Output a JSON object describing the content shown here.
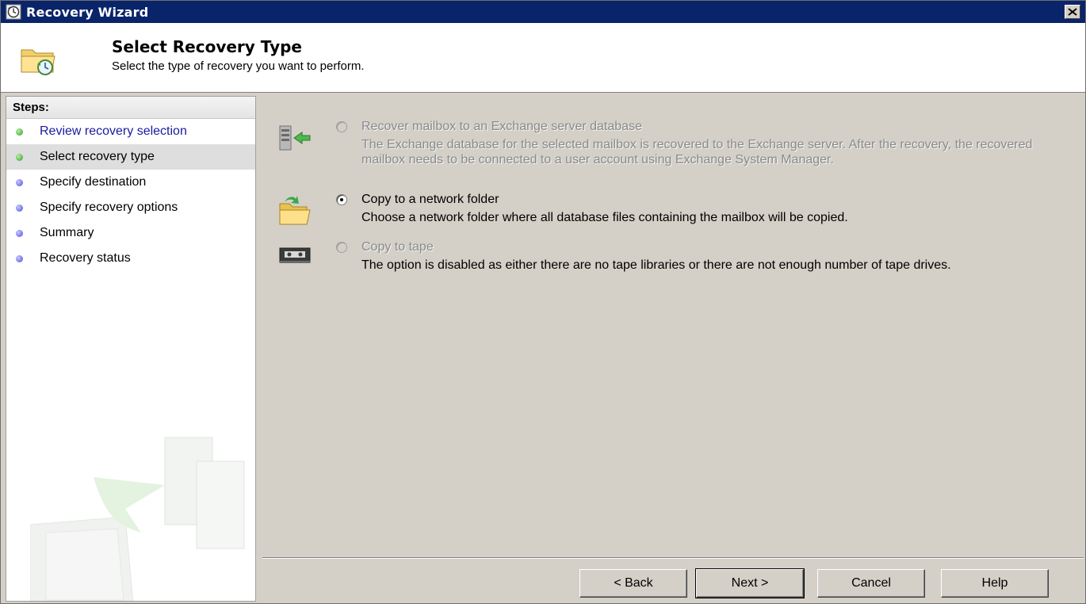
{
  "window": {
    "title": "Recovery Wizard",
    "close_icon": "close-icon"
  },
  "header": {
    "title": "Select Recovery Type",
    "subtitle": "Select the type of recovery you want to perform."
  },
  "steps": {
    "header": "Steps:",
    "items": [
      {
        "label": "Review recovery selection",
        "status": "done"
      },
      {
        "label": "Select recovery type",
        "status": "current"
      },
      {
        "label": "Specify destination",
        "status": "todo"
      },
      {
        "label": "Specify recovery options",
        "status": "todo"
      },
      {
        "label": "Summary",
        "status": "todo"
      },
      {
        "label": "Recovery status",
        "status": "todo"
      }
    ]
  },
  "options": {
    "exchange": {
      "label": "Recover mailbox to an Exchange server database",
      "description": "The Exchange database for the selected mailbox is recovered to the Exchange server.  After the recovery, the recovered mailbox needs to be connected to a user account using Exchange System Manager.",
      "enabled": false,
      "selected": false,
      "icon": "server-arrow-icon"
    },
    "network": {
      "label": "Copy to a network folder",
      "description": "Choose a network folder where all database files containing the mailbox will be copied.",
      "enabled": true,
      "selected": true,
      "icon": "folder-arrow-icon"
    },
    "tape": {
      "label": "Copy to tape",
      "description": "The option is disabled as either there are no tape libraries or there are not enough number of tape drives.",
      "enabled": false,
      "selected": false,
      "icon": "tape-icon"
    }
  },
  "buttons": {
    "back": "< Back",
    "next": "Next >",
    "cancel": "Cancel",
    "help": "Help"
  },
  "colors": {
    "titlebar": "#0a246a",
    "dialog_bg": "#d4d0c8",
    "step_done": "#2f9a2f",
    "step_todo": "#4d4dd8",
    "link": "#1a1aa0"
  }
}
